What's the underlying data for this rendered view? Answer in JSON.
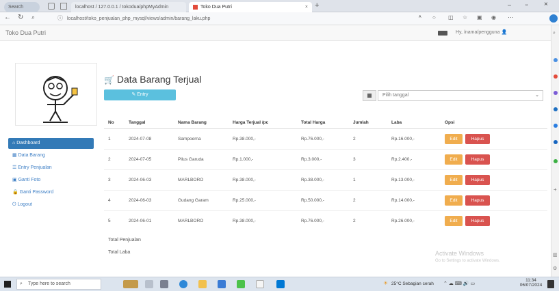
{
  "browser": {
    "tabs": [
      {
        "label": "Search"
      },
      {
        "label": "localhost / 127.0.0.1 / tokodua/phpMyAdmin"
      },
      {
        "label": "Toko Dua Putri"
      }
    ],
    "url": "localhost/toko_penjualan_php_mysql/views/admin/barang_laku.php"
  },
  "navbar": {
    "brand": "Toko Dua Putri",
    "user_label": "Hy, /nama/pengguna"
  },
  "sidebar": {
    "items": [
      {
        "label": "Dashboard",
        "active": true,
        "icon": "home-icon"
      },
      {
        "label": "Data Barang",
        "active": false,
        "icon": "table-icon"
      },
      {
        "label": "Entry Penjualan",
        "active": false,
        "icon": "list-icon"
      },
      {
        "label": "Ganti Foto",
        "active": false,
        "icon": "image-icon"
      },
      {
        "label": "Ganti Password",
        "active": false,
        "icon": "lock-icon"
      },
      {
        "label": "Logout",
        "active": false,
        "icon": "logout-icon"
      }
    ]
  },
  "main": {
    "title": "Data Barang Terjual",
    "entry_button": "Entry",
    "date_placeholder": "Pilih tanggal",
    "table": {
      "headers": [
        "No",
        "Tanggal",
        "Nama Barang",
        "Harga Terjual /pc",
        "Total Harga",
        "Jumlah",
        "Laba",
        "Opsi"
      ],
      "rows": [
        [
          "1",
          "2024-07-08",
          "Sampoerna",
          "Rp.38.000,-",
          "Rp.76.000,-",
          "2",
          "Rp.16.000,-"
        ],
        [
          "2",
          "2024-07-05",
          "Pilus Garuda",
          "Rp.1.000,-",
          "Rp.3.000,-",
          "3",
          "Rp.2.400,-"
        ],
        [
          "3",
          "2024-06-03",
          "MARLBORO",
          "Rp.38.000,-",
          "Rp.38.000,-",
          "1",
          "Rp.13.000,-"
        ],
        [
          "4",
          "2024-06-03",
          "Gudang Garam",
          "Rp.25.000,-",
          "Rp.50.000,-",
          "2",
          "Rp.14.000,-"
        ],
        [
          "5",
          "2024-06-01",
          "MARLBORO",
          "Rp.38.000,-",
          "Rp.76.000,-",
          "2",
          "Rp.26.000,-"
        ]
      ],
      "edit_label": "Edit",
      "delete_label": "Hapus"
    },
    "total_penjualan_label": "Total Penjualan",
    "total_laba_label": "Total Laba"
  },
  "watermark": {
    "line1": "Activate Windows",
    "line2": "Go to Settings to activate Windows."
  },
  "taskbar": {
    "search_placeholder": "Type here to search",
    "weather": "25°C Sebagian cerah",
    "time": "11:34",
    "date": "06/07/2024"
  },
  "colors": {
    "primary": "#337ab7",
    "info": "#5bc0de",
    "warning": "#f0ad4e",
    "danger": "#d9534f"
  }
}
